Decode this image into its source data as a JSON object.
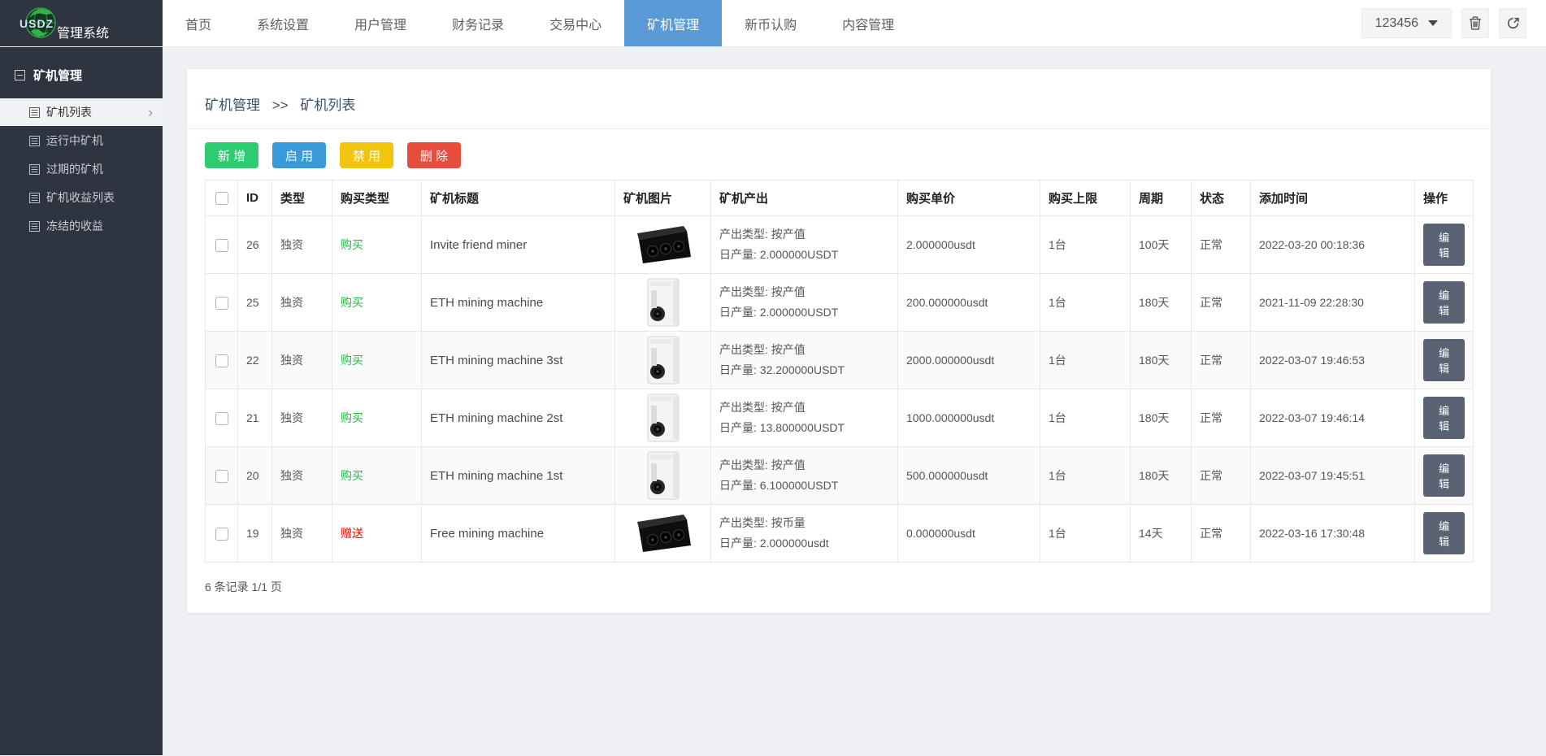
{
  "app": {
    "logo_abbr": "USDZ",
    "logo_title": "管理系统"
  },
  "colors": {
    "accent_blue": "#5b9bd5",
    "sidebar_bg": "#2e3440",
    "btn_add_green": "#2ecc71",
    "btn_enable_blue": "#3a99d8",
    "btn_disable_yellow": "#f1c40f",
    "btn_delete_red": "#e74c3c",
    "buy_type_green": "#2eb84d",
    "gift_type_red": "#ff0000",
    "edit_btn_gray": "#5a6373"
  },
  "icons": {
    "logo": "globe-icon",
    "user_menu": "caret-down-icon",
    "trash": "trash-icon",
    "logout": "logout-icon",
    "section_collapse": "minus-box-icon",
    "sidebar_item": "list-icon",
    "active_item": "chevron-right-icon"
  },
  "topnav": {
    "items": [
      {
        "label": "首页",
        "active": false
      },
      {
        "label": "系统设置",
        "active": false
      },
      {
        "label": "用户管理",
        "active": false
      },
      {
        "label": "财务记录",
        "active": false
      },
      {
        "label": "交易中心",
        "active": false
      },
      {
        "label": "矿机管理",
        "active": true
      },
      {
        "label": "新币认购",
        "active": false
      },
      {
        "label": "内容管理",
        "active": false
      }
    ],
    "user_label": "123456"
  },
  "sidebar": {
    "section_label": "矿机管理",
    "items": [
      {
        "label": "矿机列表",
        "active": true
      },
      {
        "label": "运行中矿机",
        "active": false
      },
      {
        "label": "过期的矿机",
        "active": false
      },
      {
        "label": "矿机收益列表",
        "active": false
      },
      {
        "label": "冻结的收益",
        "active": false
      }
    ]
  },
  "breadcrumb": {
    "parent": "矿机管理",
    "separator": ">>",
    "current": "矿机列表"
  },
  "toolbar": {
    "add": "新 增",
    "enable": "启 用",
    "disable": "禁 用",
    "delete": "删 除"
  },
  "table": {
    "headers": [
      "ID",
      "类型",
      "购买类型",
      "矿机标题",
      "矿机图片",
      "矿机产出",
      "购买单价",
      "购买上限",
      "周期",
      "状态",
      "添加时间",
      "操作"
    ],
    "rows": [
      {
        "id": "26",
        "type": "独资",
        "buy_type": "购买",
        "buy_kind": "buy",
        "title": "Invite friend miner",
        "image": "black-box-miner",
        "output_type": "产出类型: 按产值",
        "output_daily": "日产量: 2.000000USDT",
        "price": "2.000000usdt",
        "limit": "1台",
        "period": "100天",
        "status": "正常",
        "added": "2022-03-20 00:18:36",
        "action": "编辑"
      },
      {
        "id": "25",
        "type": "独资",
        "buy_type": "购买",
        "buy_kind": "buy",
        "title": "ETH mining machine",
        "image": "white-miner",
        "output_type": "产出类型: 按产值",
        "output_daily": "日产量: 2.000000USDT",
        "price": "200.000000usdt",
        "limit": "1台",
        "period": "180天",
        "status": "正常",
        "added": "2021-11-09 22:28:30",
        "action": "编辑"
      },
      {
        "id": "22",
        "type": "独资",
        "buy_type": "购买",
        "buy_kind": "buy",
        "title": "ETH mining machine 3st",
        "image": "white-miner",
        "output_type": "产出类型: 按产值",
        "output_daily": "日产量: 32.200000USDT",
        "price": "2000.000000usdt",
        "limit": "1台",
        "period": "180天",
        "status": "正常",
        "added": "2022-03-07 19:46:53",
        "action": "编辑"
      },
      {
        "id": "21",
        "type": "独资",
        "buy_type": "购买",
        "buy_kind": "buy",
        "title": "ETH mining machine 2st",
        "image": "white-miner",
        "output_type": "产出类型: 按产值",
        "output_daily": "日产量: 13.800000USDT",
        "price": "1000.000000usdt",
        "limit": "1台",
        "period": "180天",
        "status": "正常",
        "added": "2022-03-07 19:46:14",
        "action": "编辑"
      },
      {
        "id": "20",
        "type": "独资",
        "buy_type": "购买",
        "buy_kind": "buy",
        "title": "ETH mining machine 1st",
        "image": "white-miner",
        "output_type": "产出类型: 按产值",
        "output_daily": "日产量: 6.100000USDT",
        "price": "500.000000usdt",
        "limit": "1台",
        "period": "180天",
        "status": "正常",
        "added": "2022-03-07 19:45:51",
        "action": "编辑"
      },
      {
        "id": "19",
        "type": "独资",
        "buy_type": "赠送",
        "buy_kind": "gift",
        "title": "Free mining machine",
        "image": "black-box-miner",
        "output_type": "产出类型: 按币量",
        "output_daily": "日产量: 2.000000usdt",
        "price": "0.000000usdt",
        "limit": "1台",
        "period": "14天",
        "status": "正常",
        "added": "2022-03-16 17:30:48",
        "action": "编辑"
      }
    ]
  },
  "pagination": {
    "summary": "6 条记录 1/1 页"
  }
}
